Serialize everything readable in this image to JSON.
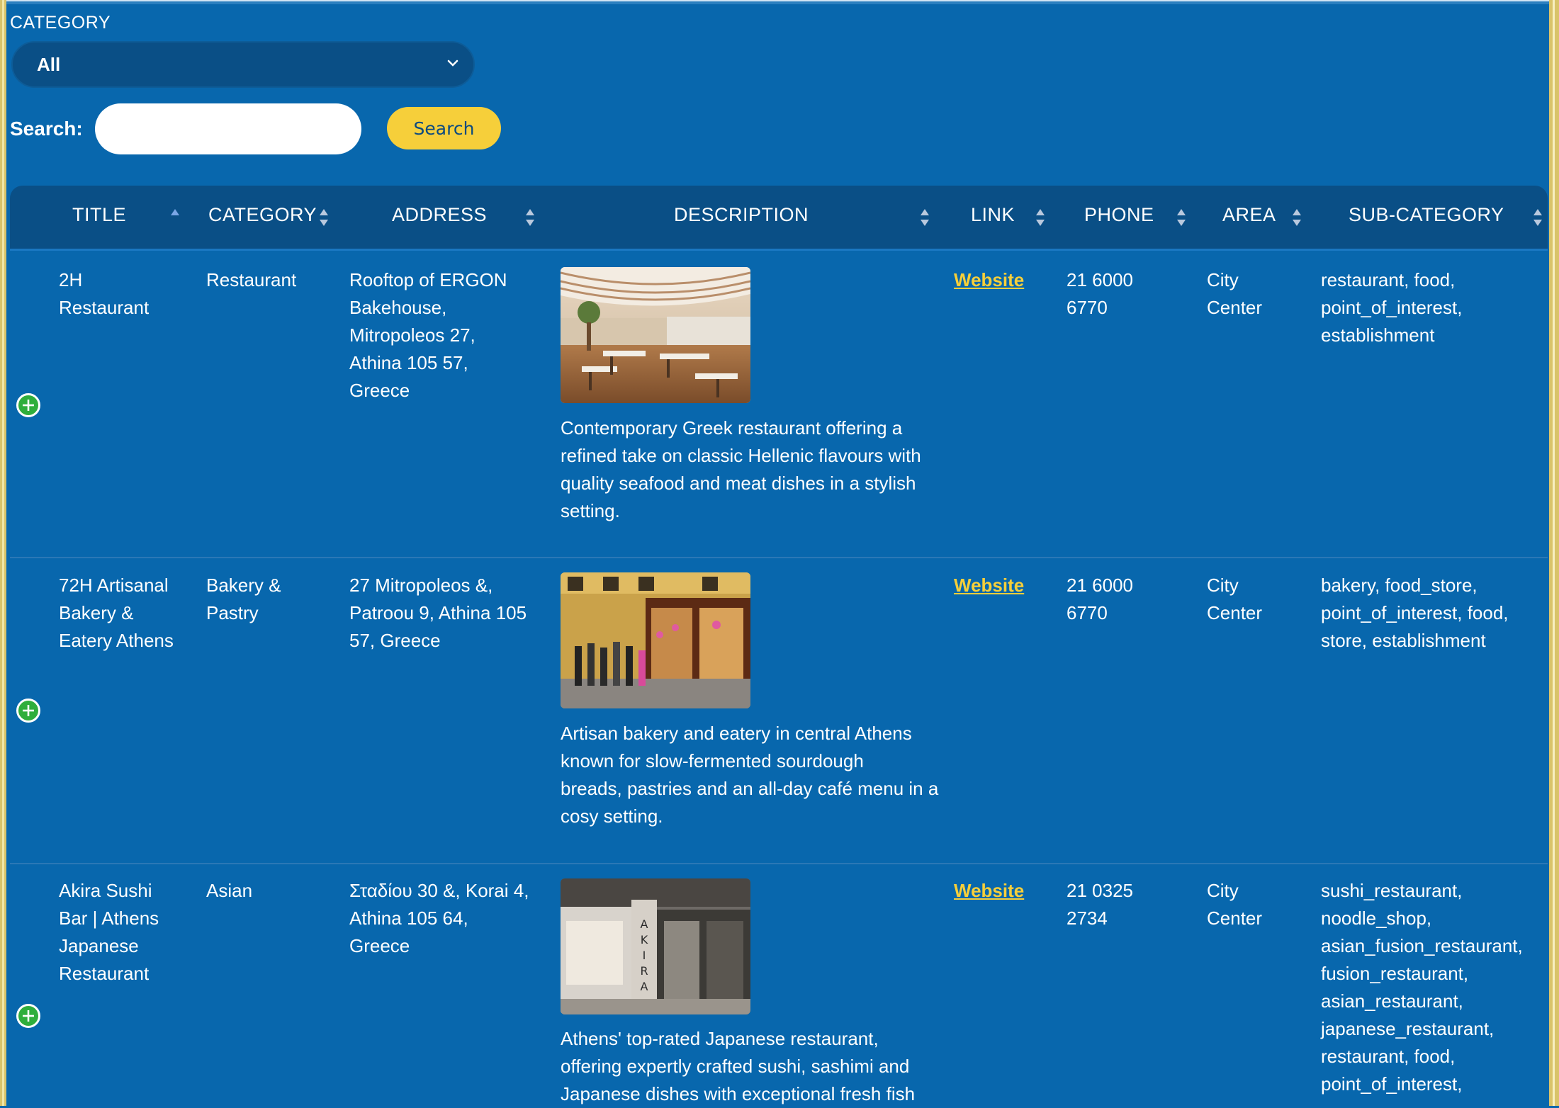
{
  "filter": {
    "label": "CATEGORY",
    "selected": "All",
    "search_label": "Search:",
    "search_value": "",
    "search_button": "Search"
  },
  "table": {
    "columns": [
      {
        "key": "title",
        "label": "TITLE",
        "sort": "ascending"
      },
      {
        "key": "category",
        "label": "CATEGORY",
        "sort": "none"
      },
      {
        "key": "address",
        "label": "ADDRESS",
        "sort": "none"
      },
      {
        "key": "description",
        "label": "DESCRIPTION",
        "sort": "none"
      },
      {
        "key": "link",
        "label": "LINK",
        "sort": "none"
      },
      {
        "key": "phone",
        "label": "PHONE",
        "sort": "none"
      },
      {
        "key": "area",
        "label": "AREA",
        "sort": "none"
      },
      {
        "key": "subcategory",
        "label": "SUB-CATEGORY",
        "sort": "none"
      }
    ],
    "rows": [
      {
        "title": [
          "2H",
          "Restaurant"
        ],
        "category": [
          "Restaurant"
        ],
        "address": [
          "Rooftop of ERGON",
          "Bakehouse,",
          "Mitropoleos 27,",
          "Athina 105 57,",
          "Greece"
        ],
        "description": [
          "Contemporary Greek restaurant offering a",
          "refined take on classic Hellenic flavours with",
          "quality seafood and meat dishes in a stylish",
          "setting."
        ],
        "link": "Website",
        "phone": [
          "21 6000",
          "6770"
        ],
        "area": [
          "City",
          "Center"
        ],
        "subcategory": [
          "restaurant, food,",
          "point_of_interest,",
          "establishment"
        ],
        "photo": "rooftop-terrace"
      },
      {
        "title": [
          "72H Artisanal",
          "Bakery &",
          "Eatery Athens"
        ],
        "category": [
          "Bakery &",
          "Pastry"
        ],
        "address": [
          "27 Mitropoleos &,",
          "Patroou 9, Athina 105",
          "57, Greece"
        ],
        "description": [
          "Artisan bakery and eatery in central Athens",
          "known for slow-fermented sourdough",
          "breads, pastries and an all-day café menu in a",
          "cosy setting."
        ],
        "link": "Website",
        "phone": [
          "21 6000",
          "6770"
        ],
        "area": [
          "City",
          "Center"
        ],
        "subcategory": [
          "bakery, food_store,",
          "point_of_interest, food,",
          "store, establishment"
        ],
        "photo": "bakery-storefront"
      },
      {
        "title": [
          "Akira Sushi",
          "Bar | Athens",
          "Japanese",
          "Restaurant"
        ],
        "category": [
          "Asian"
        ],
        "address": [
          "Σταδίου 30 &, Korai 4,",
          "Athina 105 64,",
          "Greece"
        ],
        "description": [
          "Athens' top-rated Japanese restaurant,",
          "offering expertly crafted sushi, sashimi and",
          "Japanese dishes with exceptional fresh fish"
        ],
        "link": "Website",
        "phone": [
          "21 0325",
          "2734"
        ],
        "area": [
          "City",
          "Center"
        ],
        "subcategory": [
          "sushi_restaurant,",
          "noodle_shop,",
          "asian_fusion_restaurant,",
          "fusion_restaurant,",
          "asian_restaurant,",
          "japanese_restaurant,",
          "restaurant, food,",
          "point_of_interest,"
        ],
        "photo": "akira-storefront",
        "photo_sign": "AKIRA"
      }
    ]
  },
  "colors": {
    "background": "#0867ad",
    "header": "#0a4f86",
    "accent": "#f6cf3a",
    "expand": "#2fae3c"
  },
  "icons": {
    "select": "chevron-down-icon",
    "sort": "sort-arrows-icon",
    "expand": "plus-circle-icon"
  }
}
